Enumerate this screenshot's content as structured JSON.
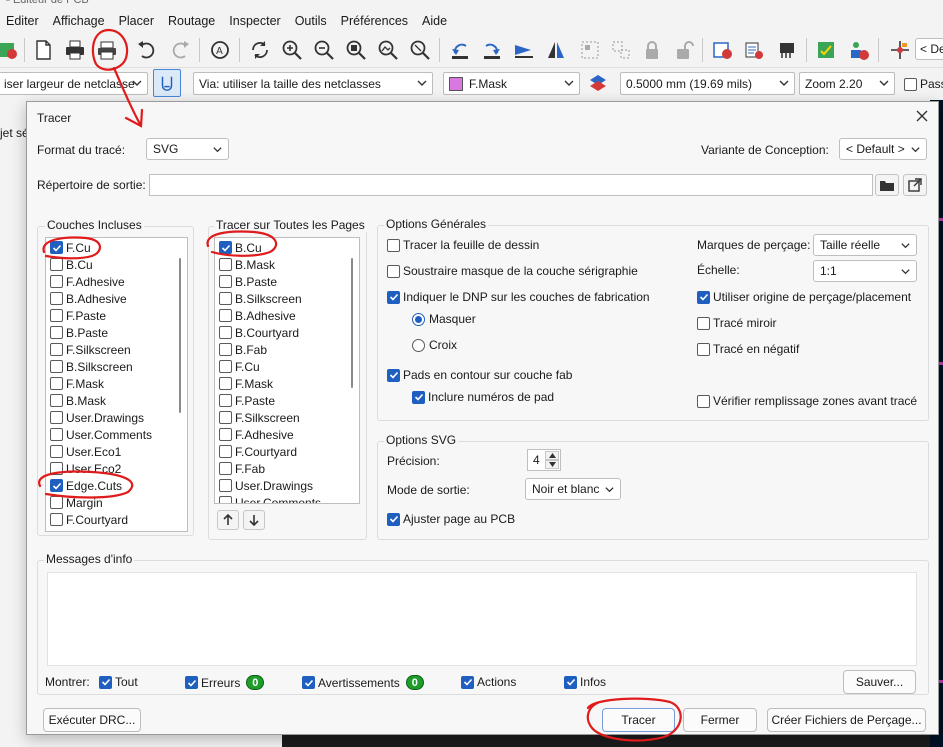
{
  "menubar": [
    "Editer",
    "Affichage",
    "Placer",
    "Routage",
    "Inspecter",
    "Outils",
    "Préférences",
    "Aide"
  ],
  "toolbar2": {
    "track_width": "iser largeur de netclasse",
    "via": "Via: utiliser la taille des netclasses",
    "layer": "F.Mask",
    "grid": "0.5000 mm (19.69 mils)",
    "zoom": "Zoom 2.20",
    "pass_label": "Pass",
    "right_tab": "De"
  },
  "left_panel_text": "jet sé",
  "dialog": {
    "title": "Tracer",
    "format_label": "Format du tracé:",
    "format_value": "SVG",
    "variant_label": "Variante de Conception:",
    "variant_value": "< Default >",
    "output_dir_label": "Répertoire de sortie:",
    "output_dir_value": "",
    "included_layers": {
      "title": "Couches Incluses",
      "items": [
        {
          "label": "F.Cu",
          "checked": true
        },
        {
          "label": "B.Cu",
          "checked": false
        },
        {
          "label": "F.Adhesive",
          "checked": false
        },
        {
          "label": "B.Adhesive",
          "checked": false
        },
        {
          "label": "F.Paste",
          "checked": false
        },
        {
          "label": "B.Paste",
          "checked": false
        },
        {
          "label": "F.Silkscreen",
          "checked": false
        },
        {
          "label": "B.Silkscreen",
          "checked": false
        },
        {
          "label": "F.Mask",
          "checked": false
        },
        {
          "label": "B.Mask",
          "checked": false
        },
        {
          "label": "User.Drawings",
          "checked": false
        },
        {
          "label": "User.Comments",
          "checked": false
        },
        {
          "label": "User.Eco1",
          "checked": false
        },
        {
          "label": "User.Eco2",
          "checked": false
        },
        {
          "label": "Edge.Cuts",
          "checked": true
        },
        {
          "label": "Margin",
          "checked": false
        },
        {
          "label": "F.Courtyard",
          "checked": false
        }
      ]
    },
    "all_pages_layers": {
      "title": "Tracer sur Toutes les Pages",
      "items": [
        {
          "label": "B.Cu",
          "checked": true
        },
        {
          "label": "B.Mask",
          "checked": false
        },
        {
          "label": "B.Paste",
          "checked": false
        },
        {
          "label": "B.Silkscreen",
          "checked": false
        },
        {
          "label": "B.Adhesive",
          "checked": false
        },
        {
          "label": "B.Courtyard",
          "checked": false
        },
        {
          "label": "B.Fab",
          "checked": false
        },
        {
          "label": "F.Cu",
          "checked": false
        },
        {
          "label": "F.Mask",
          "checked": false
        },
        {
          "label": "F.Paste",
          "checked": false
        },
        {
          "label": "F.Silkscreen",
          "checked": false
        },
        {
          "label": "F.Adhesive",
          "checked": false
        },
        {
          "label": "F.Courtyard",
          "checked": false
        },
        {
          "label": "F.Fab",
          "checked": false
        },
        {
          "label": "User.Drawings",
          "checked": false
        },
        {
          "label": "User.Comments",
          "checked": false
        }
      ]
    },
    "general": {
      "title": "Options Générales",
      "plot_sheet": "Tracer la feuille de dessin",
      "subtract_mask": "Soustraire masque de la couche sérigraphie",
      "dnp_fab": "Indiquer le DNP sur les couches de fabrication",
      "hide": "Masquer",
      "cross": "Croix",
      "pad_outline": "Pads en contour sur couche fab",
      "pad_numbers": "Inclure numéros de pad",
      "drill_marks_label": "Marques de perçage:",
      "drill_marks_value": "Taille réelle",
      "scale_label": "Échelle:",
      "scale_value": "1:1",
      "use_aux_origin": "Utiliser origine de perçage/placement",
      "mirror": "Tracé miroir",
      "negative": "Tracé en négatif",
      "check_zone_fill": "Vérifier remplissage zones avant tracé"
    },
    "svg": {
      "title": "Options SVG",
      "precision_label": "Précision:",
      "precision_value": "4",
      "output_mode_label": "Mode de sortie:",
      "output_mode_value": "Noir et blanc",
      "fit_page": "Ajuster page au PCB"
    },
    "messages": {
      "title": "Messages d'info",
      "show_label": "Montrer:",
      "all": "Tout",
      "errors": "Erreurs",
      "errors_count": "0",
      "warnings": "Avertissements",
      "warnings_count": "0",
      "actions": "Actions",
      "infos": "Infos",
      "save": "Sauver..."
    },
    "buttons": {
      "drc": "Exécuter DRC...",
      "plot": "Tracer",
      "close": "Fermer",
      "drill": "Créer Fichiers de Perçage..."
    }
  },
  "colors": {
    "accent": "#1f5fbf",
    "annotation": "#e01b1b",
    "badge": "#1f9d2a",
    "layer_fmask": "#d779e0"
  }
}
